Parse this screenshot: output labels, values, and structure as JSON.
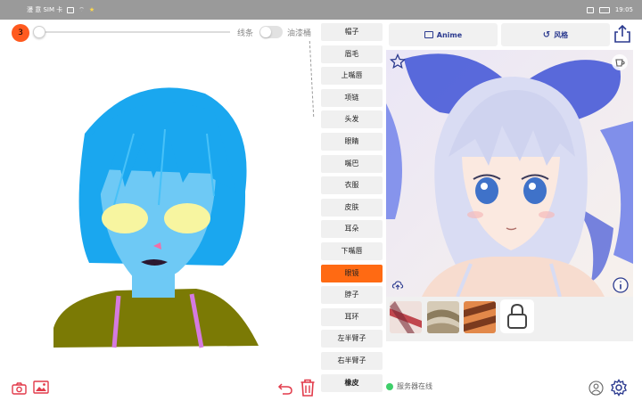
{
  "status_bar": {
    "left_text": "漫 意 SIM 卡",
    "time": "19:05"
  },
  "toolbar": {
    "brush_size_label": "3",
    "line_label": "线条",
    "bucket_label": "油漆桶"
  },
  "parts": {
    "items": [
      {
        "label": "帽子",
        "active": false
      },
      {
        "label": "眉毛",
        "active": false
      },
      {
        "label": "上嘴唇",
        "active": false
      },
      {
        "label": "项链",
        "active": false
      },
      {
        "label": "头发",
        "active": false
      },
      {
        "label": "眼睛",
        "active": false
      },
      {
        "label": "嘴巴",
        "active": false
      },
      {
        "label": "衣服",
        "active": false
      },
      {
        "label": "皮肤",
        "active": false
      },
      {
        "label": "耳朵",
        "active": false
      },
      {
        "label": "下嘴唇",
        "active": false
      },
      {
        "label": "眼镜",
        "active": true
      },
      {
        "label": "脖子",
        "active": false
      },
      {
        "label": "耳环",
        "active": false
      },
      {
        "label": "左半臂子",
        "active": false
      },
      {
        "label": "右半臂子",
        "active": false
      },
      {
        "label": "橡皮",
        "active": false
      }
    ]
  },
  "result_panel": {
    "anime_button": "Anime",
    "style_button": "风格"
  },
  "server_status": "服务器在线",
  "colors": {
    "accent": "#ff6a13",
    "hair": "#1aa7ef",
    "skin": "#6ec9f5",
    "shirt": "#7b7a05",
    "glasses": "#f7f5a0",
    "toolbar_red": "#e23a4a",
    "server_online": "#3ecf6a"
  }
}
